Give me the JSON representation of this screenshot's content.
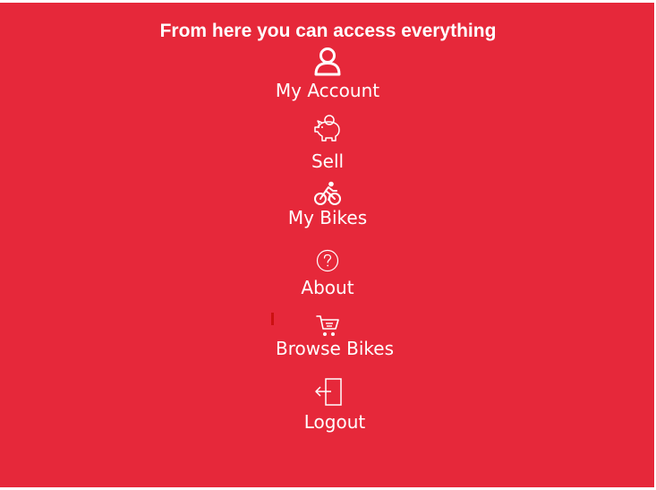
{
  "header": {
    "title": "From here you can access everything"
  },
  "menu": {
    "items": [
      {
        "label": "My Account",
        "icon": "user-icon"
      },
      {
        "label": "Sell",
        "icon": "piggy-bank-icon"
      },
      {
        "label": "My Bikes",
        "icon": "cyclist-icon"
      },
      {
        "label": "About",
        "icon": "question-circle-icon"
      },
      {
        "label": "Browse Bikes",
        "icon": "shopping-cart-icon"
      },
      {
        "label": "Logout",
        "icon": "logout-door-icon"
      }
    ]
  },
  "colors": {
    "background": "#e6283a",
    "text": "#ffffff",
    "cursor_mark": "#cc1111"
  }
}
